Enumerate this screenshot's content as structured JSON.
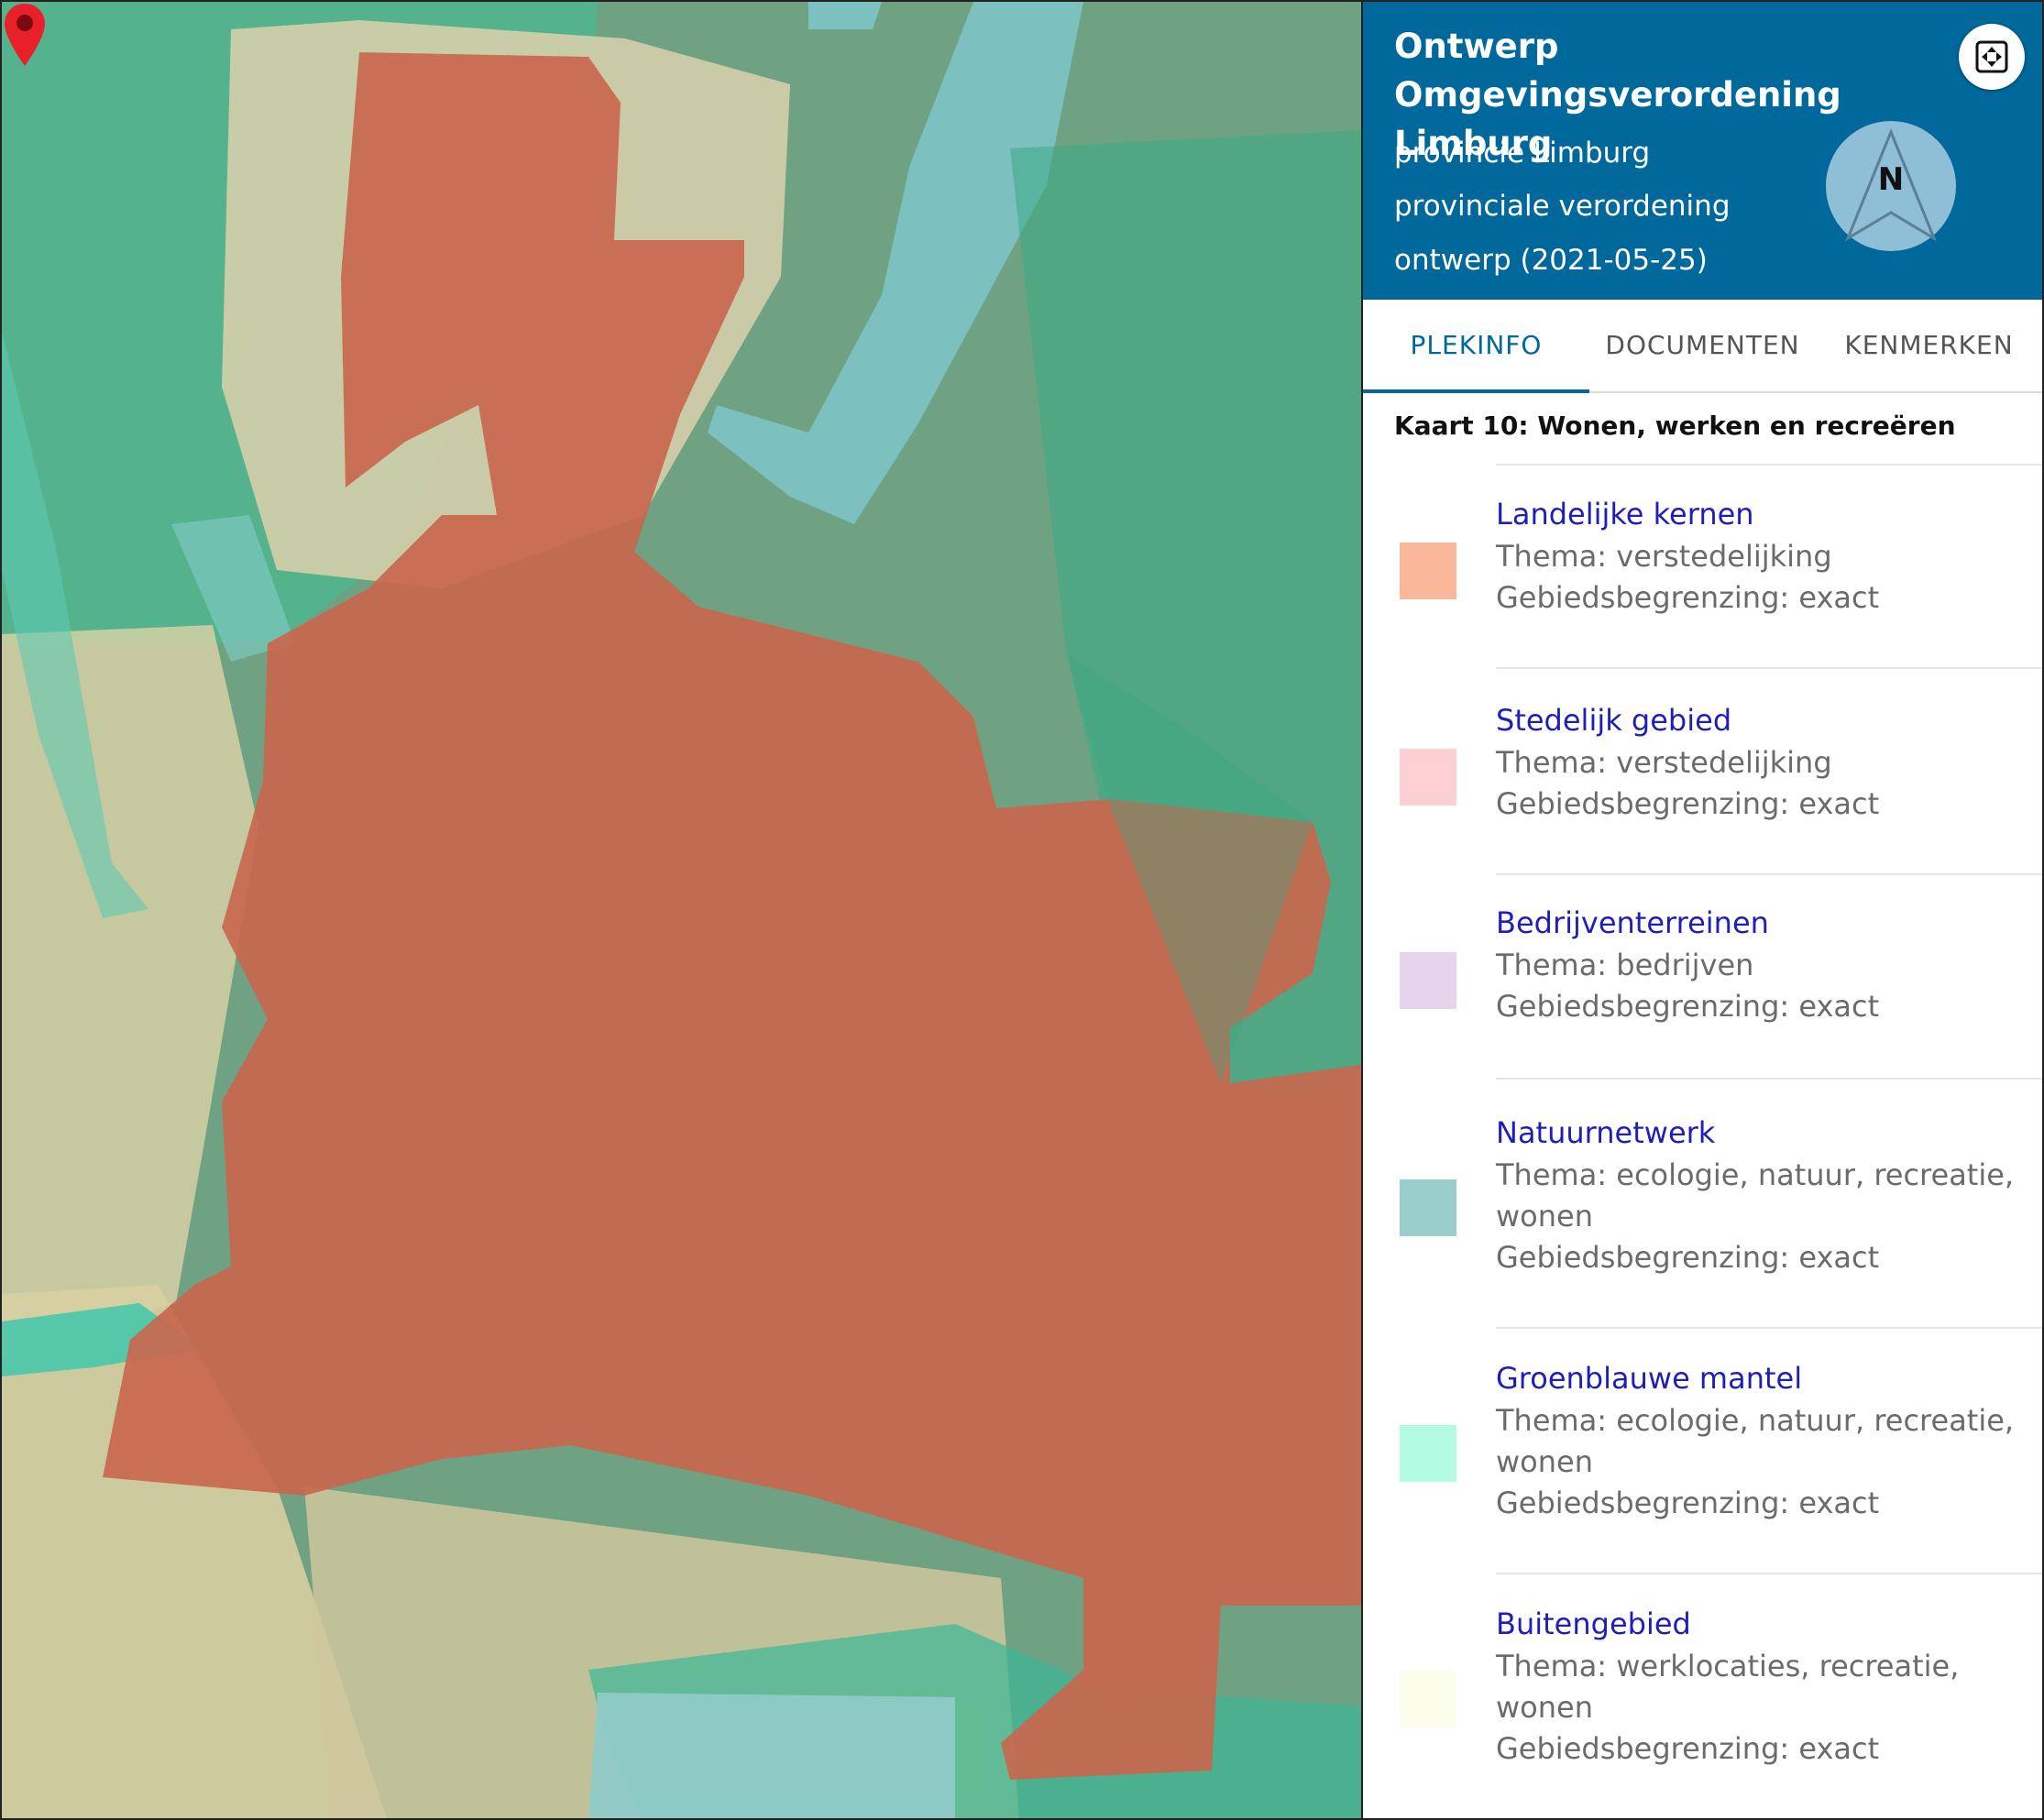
{
  "app": {
    "title": "Ontwerp Omgevingsverordening Limburg",
    "authority": "provincie Limburg",
    "doc_type": "provinciale verordening",
    "status": "ontwerp (2021-05-25)",
    "compass_label": "N"
  },
  "tabs": [
    {
      "label": "PLEKINFO",
      "active": true
    },
    {
      "label": "DOCUMENTEN",
      "active": false
    },
    {
      "label": "KENMERKEN",
      "active": false
    }
  ],
  "kaart_title": "Kaart 10: Wonen, werken en recreëren",
  "legend": [
    {
      "name": "Landelijke kernen",
      "lines": [
        "Thema: verstedelijking",
        "Gebiedsbegrenzing: exact"
      ],
      "color": "#fbb79a"
    },
    {
      "name": "Stedelijk gebied",
      "lines": [
        "Thema: verstedelijking",
        "Gebiedsbegrenzing: exact"
      ],
      "color": "#fdd1d4"
    },
    {
      "name": "Bedrijventerreinen",
      "lines": [
        "Thema: bedrijven",
        "Gebiedsbegrenzing: exact"
      ],
      "color": "#e6d3ec"
    },
    {
      "name": "Natuurnetwerk",
      "lines": [
        "Thema: ecologie, natuur, recreatie,",
        "wonen",
        "Gebiedsbegrenzing: exact"
      ],
      "color": "#9acecb"
    },
    {
      "name": "Groenblauwe mantel",
      "lines": [
        "Thema: ecologie, natuur, recreatie,",
        "wonen",
        "Gebiedsbegrenzing: exact"
      ],
      "color": "#b4fbe4"
    },
    {
      "name": "Buitengebied",
      "lines": [
        "Thema: werklocaties, recreatie,",
        "wonen",
        "Gebiedsbegrenzing: exact"
      ],
      "color": "#fdfdeb"
    }
  ],
  "map_colors": {
    "landelijke_kernen_overlay": "#c8674e",
    "natuurnetwerk_overlay": "#7bc4bd",
    "groenblauwe_mantel_overlay": "#5ec9a0",
    "buitengebied_overlay": "#d9d2ae",
    "marker": "#e8202a"
  },
  "icons": {
    "fullscreen": "fullscreen-icon",
    "compass": "compass-icon",
    "marker": "location-pin-icon"
  }
}
